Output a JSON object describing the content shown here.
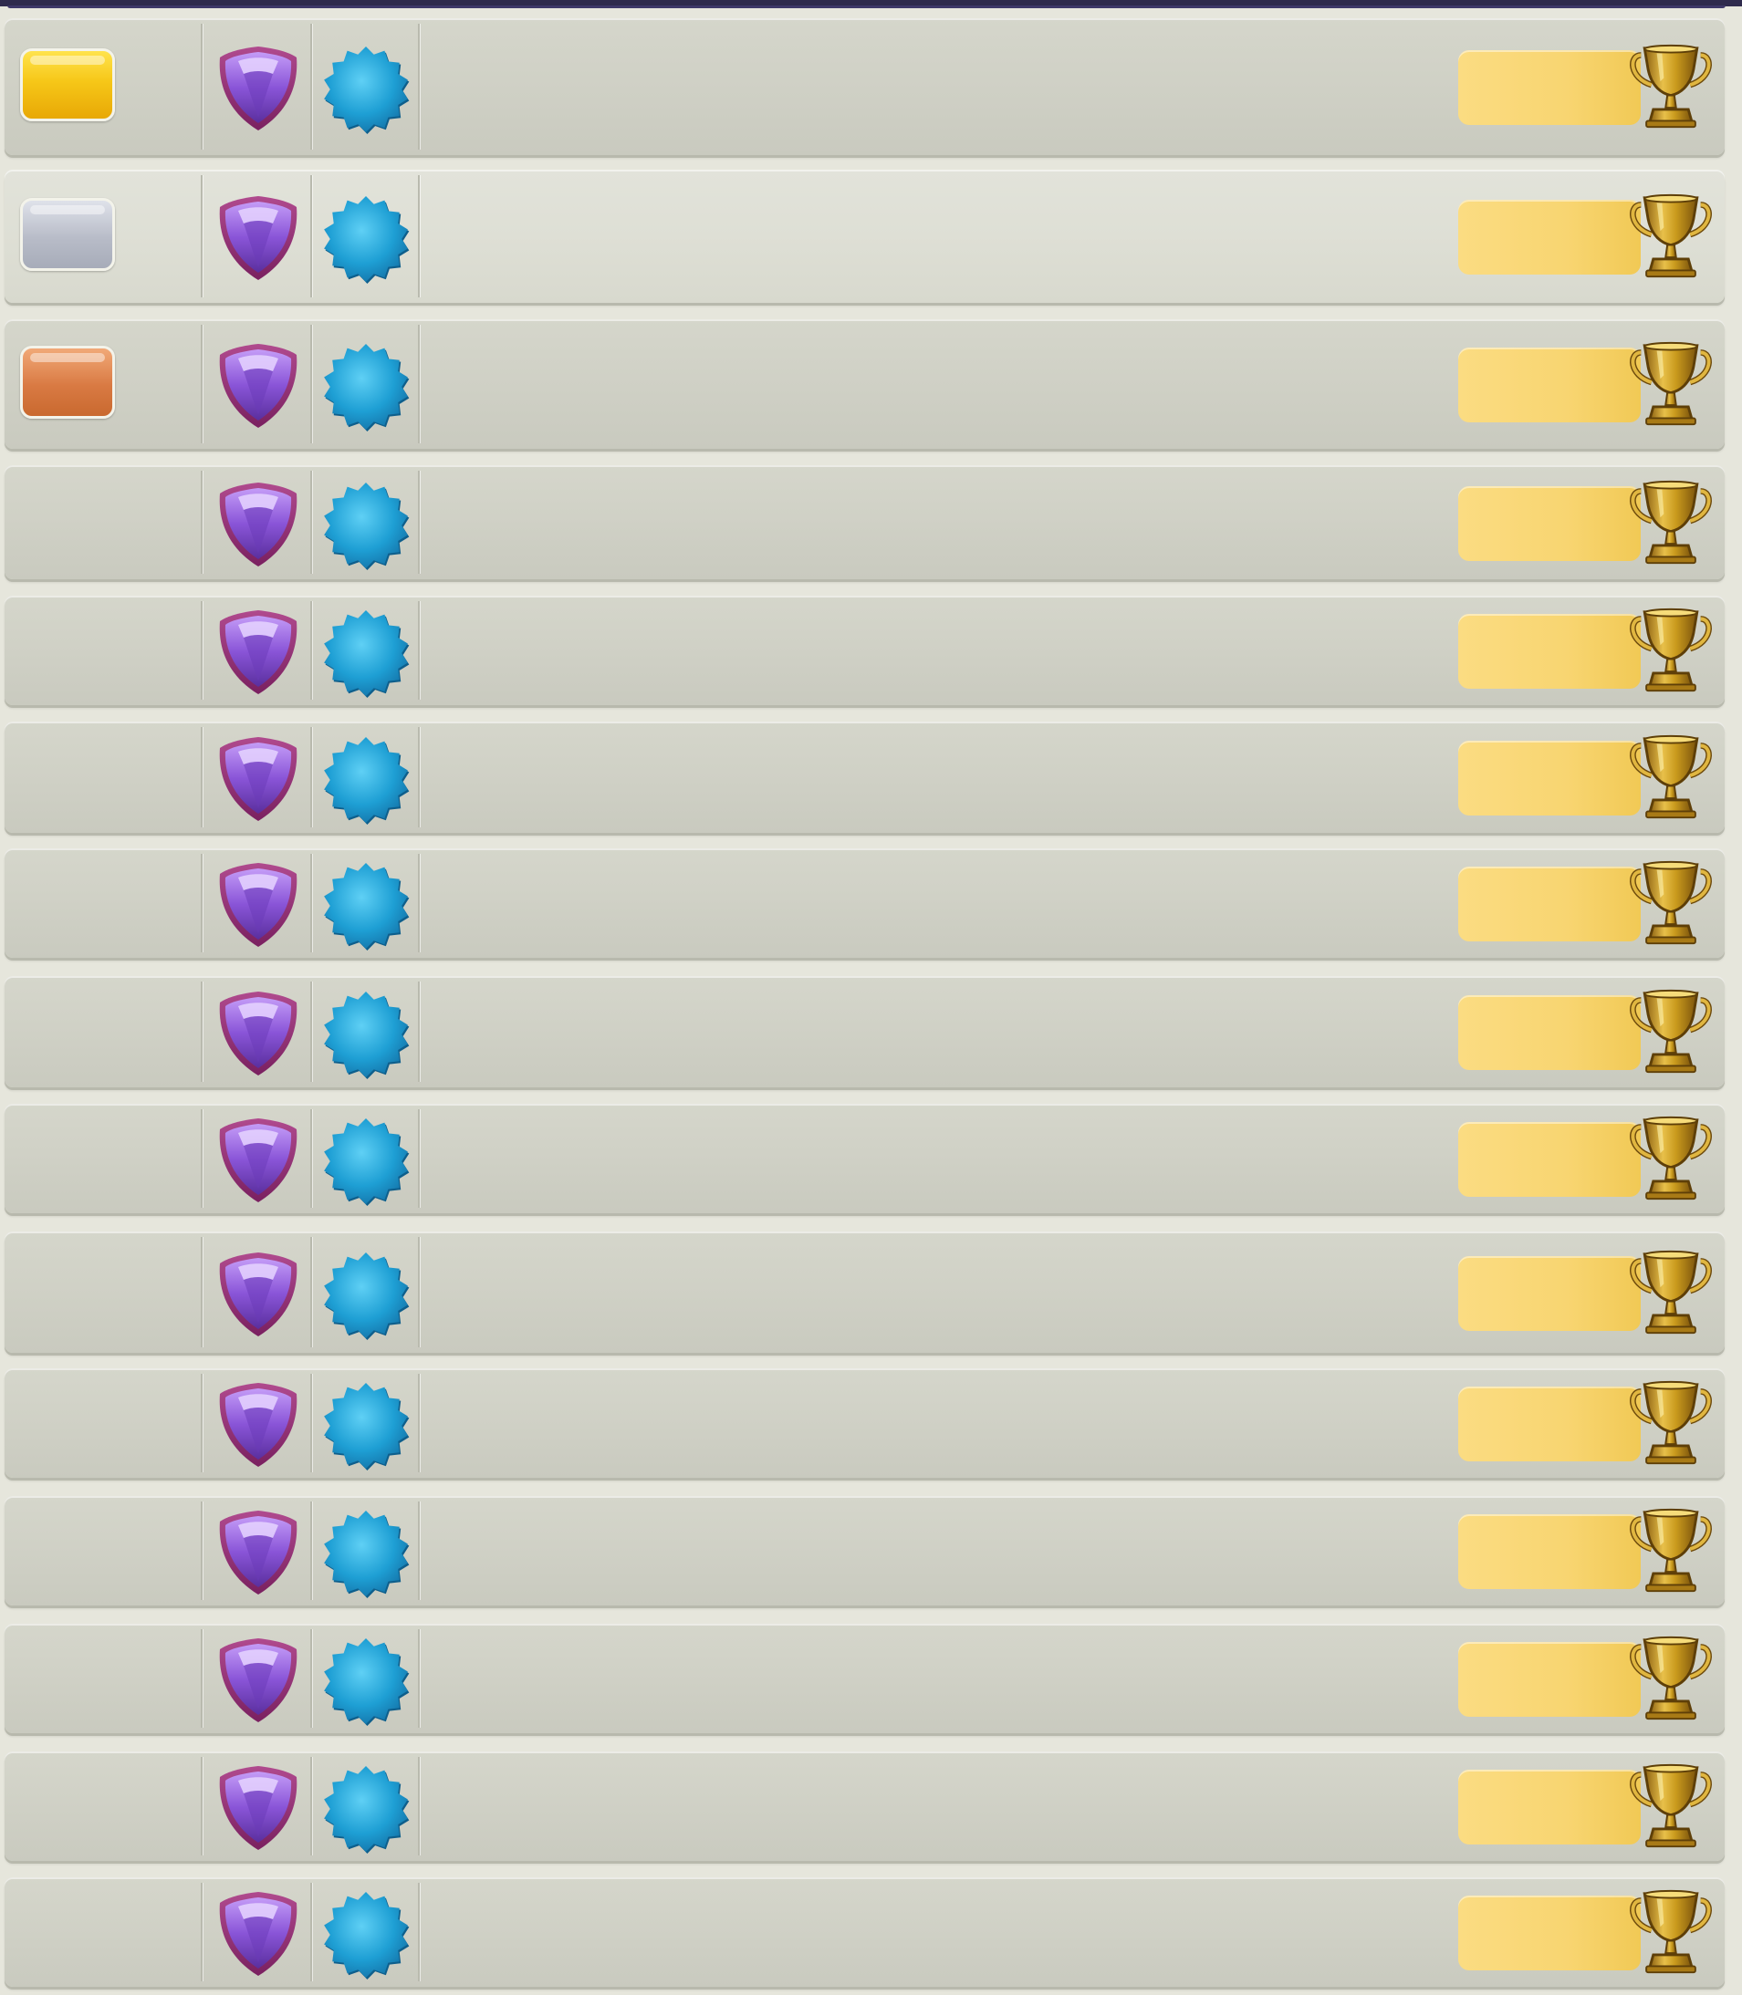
{
  "colors": {
    "header_bar": "#2f2b4d",
    "row_bg": "#d0d1c6",
    "row_highlight_bg": "#dedfd5",
    "gold_medal": "#f6c718",
    "silver_medal": "#b8bcc8",
    "bronze_medal": "#d97a43",
    "league_shield": "#8a55d8",
    "clan_badge": "#1e9fd4",
    "trophy_box": "#f8d571",
    "trophy": "#c99a1d"
  },
  "icons": {
    "league": "league-shield-icon",
    "clan": "clan-badge-icon",
    "trophy": "trophy-icon",
    "medal": "rank-medal-icon"
  },
  "leaderboard": {
    "rows": [
      {
        "medal": "gold",
        "highlight": false
      },
      {
        "medal": "silver",
        "highlight": true
      },
      {
        "medal": "bronze",
        "highlight": false
      },
      {
        "medal": "none",
        "highlight": false
      },
      {
        "medal": "none",
        "highlight": false
      },
      {
        "medal": "none",
        "highlight": false
      },
      {
        "medal": "none",
        "highlight": false
      },
      {
        "medal": "none",
        "highlight": false
      },
      {
        "medal": "none",
        "highlight": false
      },
      {
        "medal": "none",
        "highlight": false
      },
      {
        "medal": "none",
        "highlight": false
      },
      {
        "medal": "none",
        "highlight": false
      },
      {
        "medal": "none",
        "highlight": false
      },
      {
        "medal": "none",
        "highlight": false
      },
      {
        "medal": "none",
        "highlight": false
      }
    ]
  }
}
